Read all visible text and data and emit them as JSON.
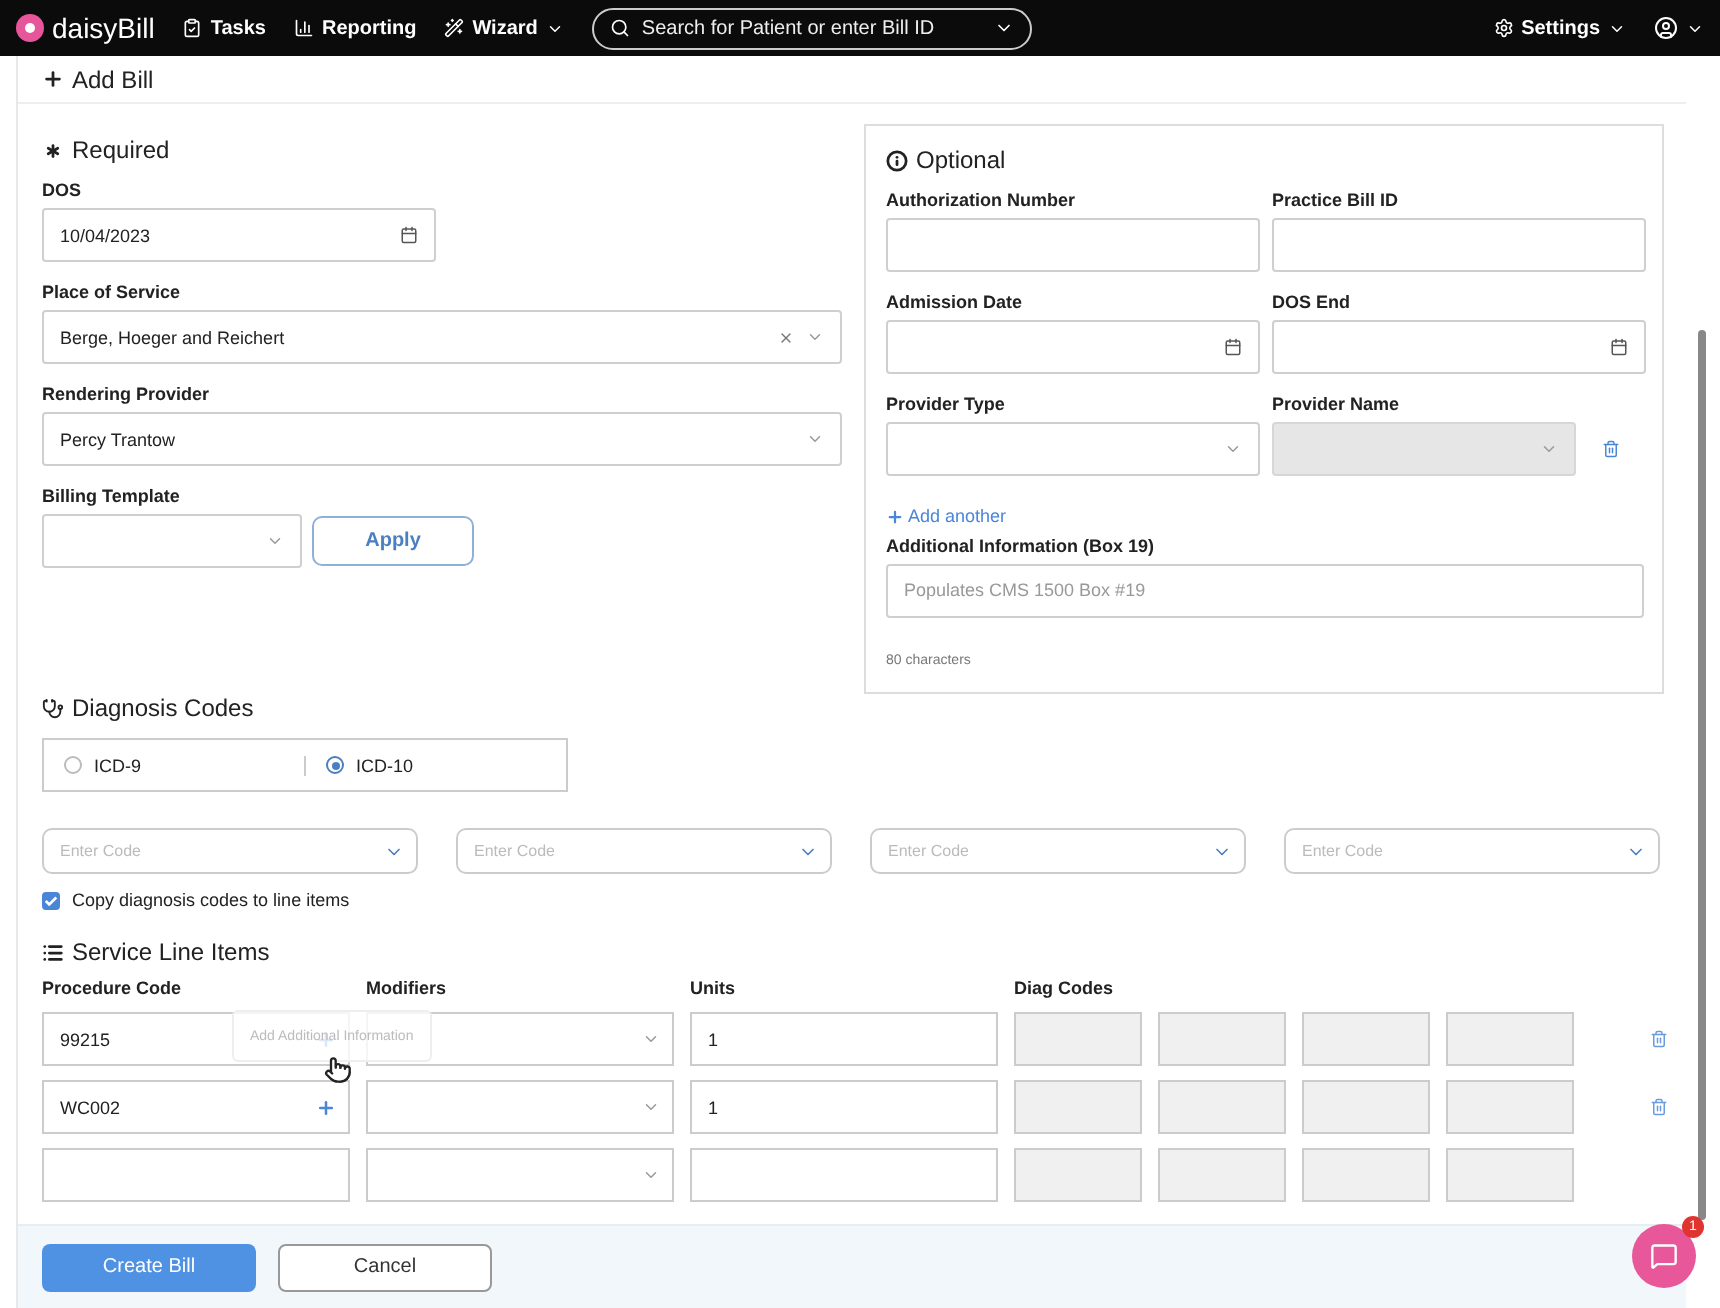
{
  "nav": {
    "logo": "daisyBill",
    "items": [
      {
        "kind": "tasks",
        "label": "Tasks",
        "menu": false
      },
      {
        "kind": "reporting",
        "label": "Reporting",
        "menu": false
      },
      {
        "kind": "wizard",
        "label": "Wizard",
        "menu": true
      }
    ],
    "search_placeholder": "Search for Patient or enter Bill ID",
    "settings": "Settings"
  },
  "page_title": "Add Bill",
  "required": {
    "title": "Required",
    "dos": {
      "label": "DOS",
      "value": "10/04/2023"
    },
    "place_of_service": {
      "label": "Place of Service",
      "value": "Berge, Hoeger and Reichert"
    },
    "rendering_provider": {
      "label": "Rendering Provider",
      "value": "Percy Trantow"
    },
    "billing_template": {
      "label": "Billing Template"
    },
    "apply": "Apply"
  },
  "optional": {
    "title": "Optional",
    "fields": [
      {
        "kind": "text",
        "label": "Authorization Number"
      },
      {
        "kind": "text",
        "label": "Practice Bill ID"
      },
      {
        "kind": "date",
        "label": "Admission Date"
      },
      {
        "kind": "date",
        "label": "DOS End"
      },
      {
        "kind": "select",
        "label": "Provider Type",
        "disabled": false
      },
      {
        "kind": "select",
        "label": "Provider Name",
        "disabled": true,
        "removable": true
      }
    ],
    "add_another": "Add another",
    "additional_info": {
      "label": "Additional Information (Box 19)",
      "placeholder": "Populates CMS 1500 Box #19",
      "hint": "80 characters"
    }
  },
  "diagnosis": {
    "title": "Diagnosis Codes",
    "code_sets": [
      {
        "label": "ICD-9",
        "selected": false
      },
      {
        "label": "ICD-10",
        "selected": true
      }
    ],
    "code_inputs": [
      {
        "placeholder": "Enter Code"
      },
      {
        "placeholder": "Enter Code"
      },
      {
        "placeholder": "Enter Code"
      },
      {
        "placeholder": "Enter Code"
      }
    ],
    "copy_codes": {
      "label": "Copy diagnosis codes to line items",
      "checked": true
    }
  },
  "service_lines": {
    "title": "Service Line Items",
    "tooltip": "Add Additional Information",
    "columns": [
      "Procedure Code",
      "Modifiers",
      "Units",
      "Diag Codes"
    ],
    "rows": [
      {
        "procedure_code": "99215",
        "units": "1",
        "filled": true
      },
      {
        "procedure_code": "WC002",
        "units": "1",
        "filled": true
      },
      {
        "filled": false
      }
    ]
  },
  "footer": {
    "create": "Create Bill",
    "cancel": "Cancel"
  },
  "chat": {
    "badge": "1"
  }
}
